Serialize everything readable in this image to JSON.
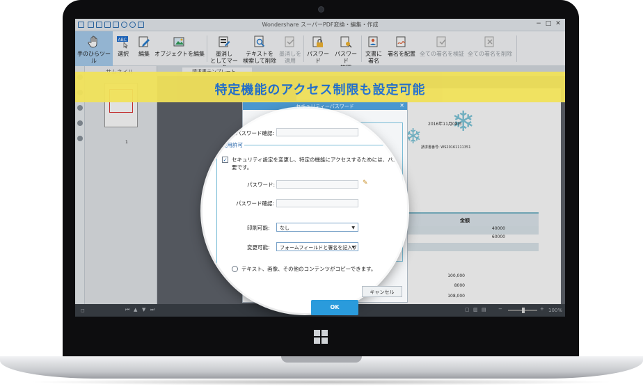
{
  "app": {
    "title": "Wondershare スーパーPDF変換・編集・作成"
  },
  "window_controls": [
    "−",
    "□",
    "✕"
  ],
  "ribbon": {
    "items": [
      {
        "label_1": "手のひらツール",
        "label_2": "",
        "icon": "hand-icon",
        "active": true,
        "disabled": false
      },
      {
        "label_1": "選択",
        "label_2": "",
        "icon": "select-text-icon",
        "active": false,
        "disabled": false
      },
      {
        "label_1": "編集",
        "label_2": "",
        "icon": "edit-pen-icon",
        "active": false,
        "disabled": false
      },
      {
        "label_1": "オブジェクトを編集",
        "label_2": "",
        "icon": "edit-object-icon",
        "active": false,
        "disabled": false
      },
      {
        "label_1": "墨消し",
        "label_2": "としてマーク",
        "icon": "redact-mark-icon",
        "active": false,
        "disabled": false
      },
      {
        "label_1": "テキストを",
        "label_2": "検索して削除",
        "icon": "search-redact-icon",
        "active": false,
        "disabled": false
      },
      {
        "label_1": "墨消しを",
        "label_2": "適用",
        "icon": "apply-redaction-icon",
        "active": false,
        "disabled": true
      },
      {
        "label_1": "パスワード",
        "label_2": "",
        "icon": "lock-icon",
        "active": false,
        "disabled": false
      },
      {
        "label_1": "パスワード",
        "label_2": "管理",
        "icon": "password-manage-icon",
        "active": false,
        "disabled": false
      },
      {
        "label_1": "文書に",
        "label_2": "署名",
        "icon": "sign-document-icon",
        "active": false,
        "disabled": false
      },
      {
        "label_1": "署名を配置",
        "label_2": "",
        "icon": "place-signature-icon",
        "active": false,
        "disabled": false
      },
      {
        "label_1": "全ての署名を検証",
        "label_2": "",
        "icon": "verify-signatures-icon",
        "active": false,
        "disabled": true
      },
      {
        "label_1": "全ての署名を削除",
        "label_2": "",
        "icon": "delete-signatures-icon",
        "active": false,
        "disabled": true
      }
    ]
  },
  "thumbnails": {
    "header": "サムネイル",
    "page_number": "1"
  },
  "tabs": {
    "doc_tab": "請求書テンプレート"
  },
  "document": {
    "date": "2016年11月08日",
    "invoice_no": "請求書番号: WS20161111351",
    "table_header": "金額",
    "rows": [
      "40000",
      "60000"
    ],
    "amounts": [
      "100,000",
      "8000",
      "108,000"
    ]
  },
  "statusbar": {
    "zoom": "100%"
  },
  "banner": {
    "text": "特定機能のアクセス制限も設定可能"
  },
  "dialog": {
    "title": "セキュリティーパスワード",
    "open_password_confirm_label": "パスワード確認:",
    "permissions_group": "使用許可",
    "restrict_checkbox_label_1": "セキュリティ設定を変更し、特定の機能にアクセスするためには、パスワードが必",
    "restrict_checkbox_label_2": "要です。",
    "password_label": "パスワード:",
    "password_confirm_label": "パスワード確認:",
    "print_label": "印刷可能:",
    "print_value": "なし",
    "change_label": "変更可能:",
    "change_value": "フォームフィールドと署名を記入す",
    "copy_label": "テキスト、画像、その他のコンテンツがコピーできます。",
    "ok": "OK",
    "cancel": "キャンセル"
  },
  "colors": {
    "accent": "#2a9bdc",
    "banner_bg": "#f0e15a",
    "banner_text": "#1f6fd0",
    "ribbon_active": "#a8cdee"
  }
}
